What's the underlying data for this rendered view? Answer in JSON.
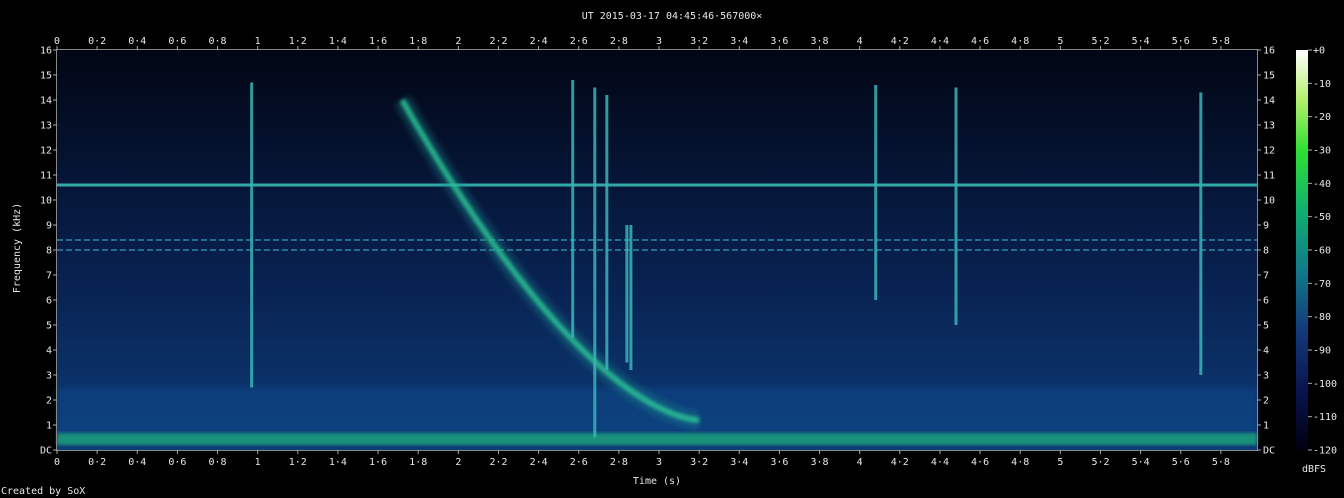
{
  "chart_data": {
    "type": "heatmap",
    "title": "UT 2015-03-17 04:45:46·567000×",
    "xlabel": "Time (s)",
    "ylabel": "Frequency (kHz)",
    "xlim": [
      0,
      5.98
    ],
    "ylim": [
      0,
      16
    ],
    "x_ticks": [
      "0",
      "0·2",
      "0·4",
      "0·6",
      "0·8",
      "1",
      "1·2",
      "1·4",
      "1·6",
      "1·8",
      "2",
      "2·2",
      "2·4",
      "2·6",
      "2·8",
      "3",
      "3·2",
      "3·4",
      "3·6",
      "3·8",
      "4",
      "4·2",
      "4·4",
      "4·6",
      "4·8",
      "5",
      "5·2",
      "5·4",
      "5·6",
      "5·8"
    ],
    "x_tick_values": [
      0,
      0.2,
      0.4,
      0.6,
      0.8,
      1,
      1.2,
      1.4,
      1.6,
      1.8,
      2,
      2.2,
      2.4,
      2.6,
      2.8,
      3,
      3.2,
      3.4,
      3.6,
      3.8,
      4,
      4.2,
      4.4,
      4.6,
      4.8,
      5,
      5.2,
      5.4,
      5.6,
      5.8
    ],
    "y_ticks": [
      "DC",
      "1",
      "2",
      "3",
      "4",
      "5",
      "6",
      "7",
      "8",
      "9",
      "10",
      "11",
      "12",
      "13",
      "14",
      "15",
      "16"
    ],
    "y_tick_values": [
      0,
      1,
      2,
      3,
      4,
      5,
      6,
      7,
      8,
      9,
      10,
      11,
      12,
      13,
      14,
      15,
      16
    ],
    "colorbar": {
      "label": "dBFS",
      "ticks": [
        "+0",
        "-10",
        "-20",
        "-30",
        "-40",
        "-50",
        "-60",
        "-70",
        "-80",
        "-90",
        "-100",
        "-110",
        "-120"
      ],
      "tick_values": [
        0,
        -10,
        -20,
        -30,
        -40,
        -50,
        -60,
        -70,
        -80,
        -90,
        -100,
        -110,
        -120
      ],
      "range": [
        -120,
        0
      ]
    },
    "features": [
      {
        "kind": "horizontal_line",
        "freq_khz": 10.6
      },
      {
        "kind": "horizontal_line",
        "freq_khz": 8.4
      },
      {
        "kind": "horizontal_line",
        "freq_khz": 8.0
      },
      {
        "kind": "low_band",
        "freq_khz": [
          0.2,
          0.7
        ]
      },
      {
        "kind": "whistler",
        "start_time_s": 1.72,
        "start_freq_khz": 14,
        "end_time_s": 3.2,
        "end_freq_khz": 1.2
      },
      {
        "kind": "vertical_spike",
        "time_s": 0.97,
        "freq_khz": [
          2.5,
          14.7
        ]
      },
      {
        "kind": "vertical_spike",
        "time_s": 2.57,
        "freq_khz": [
          4.5,
          14.8
        ]
      },
      {
        "kind": "vertical_spike",
        "time_s": 2.68,
        "freq_khz": [
          0.5,
          14.5
        ]
      },
      {
        "kind": "vertical_spike",
        "time_s": 2.74,
        "freq_khz": [
          3.2,
          14.2
        ]
      },
      {
        "kind": "vertical_spike",
        "time_s": 2.84,
        "freq_khz": [
          3.5,
          9
        ]
      },
      {
        "kind": "vertical_spike",
        "time_s": 2.86,
        "freq_khz": [
          3.2,
          9
        ]
      },
      {
        "kind": "vertical_spike",
        "time_s": 4.08,
        "freq_khz": [
          6,
          14.6
        ]
      },
      {
        "kind": "vertical_spike",
        "time_s": 4.48,
        "freq_khz": [
          5,
          14.5
        ]
      },
      {
        "kind": "vertical_spike",
        "time_s": 5.7,
        "freq_khz": [
          3,
          14.3
        ]
      }
    ]
  },
  "footer": {
    "credit": "Created by SoX"
  }
}
